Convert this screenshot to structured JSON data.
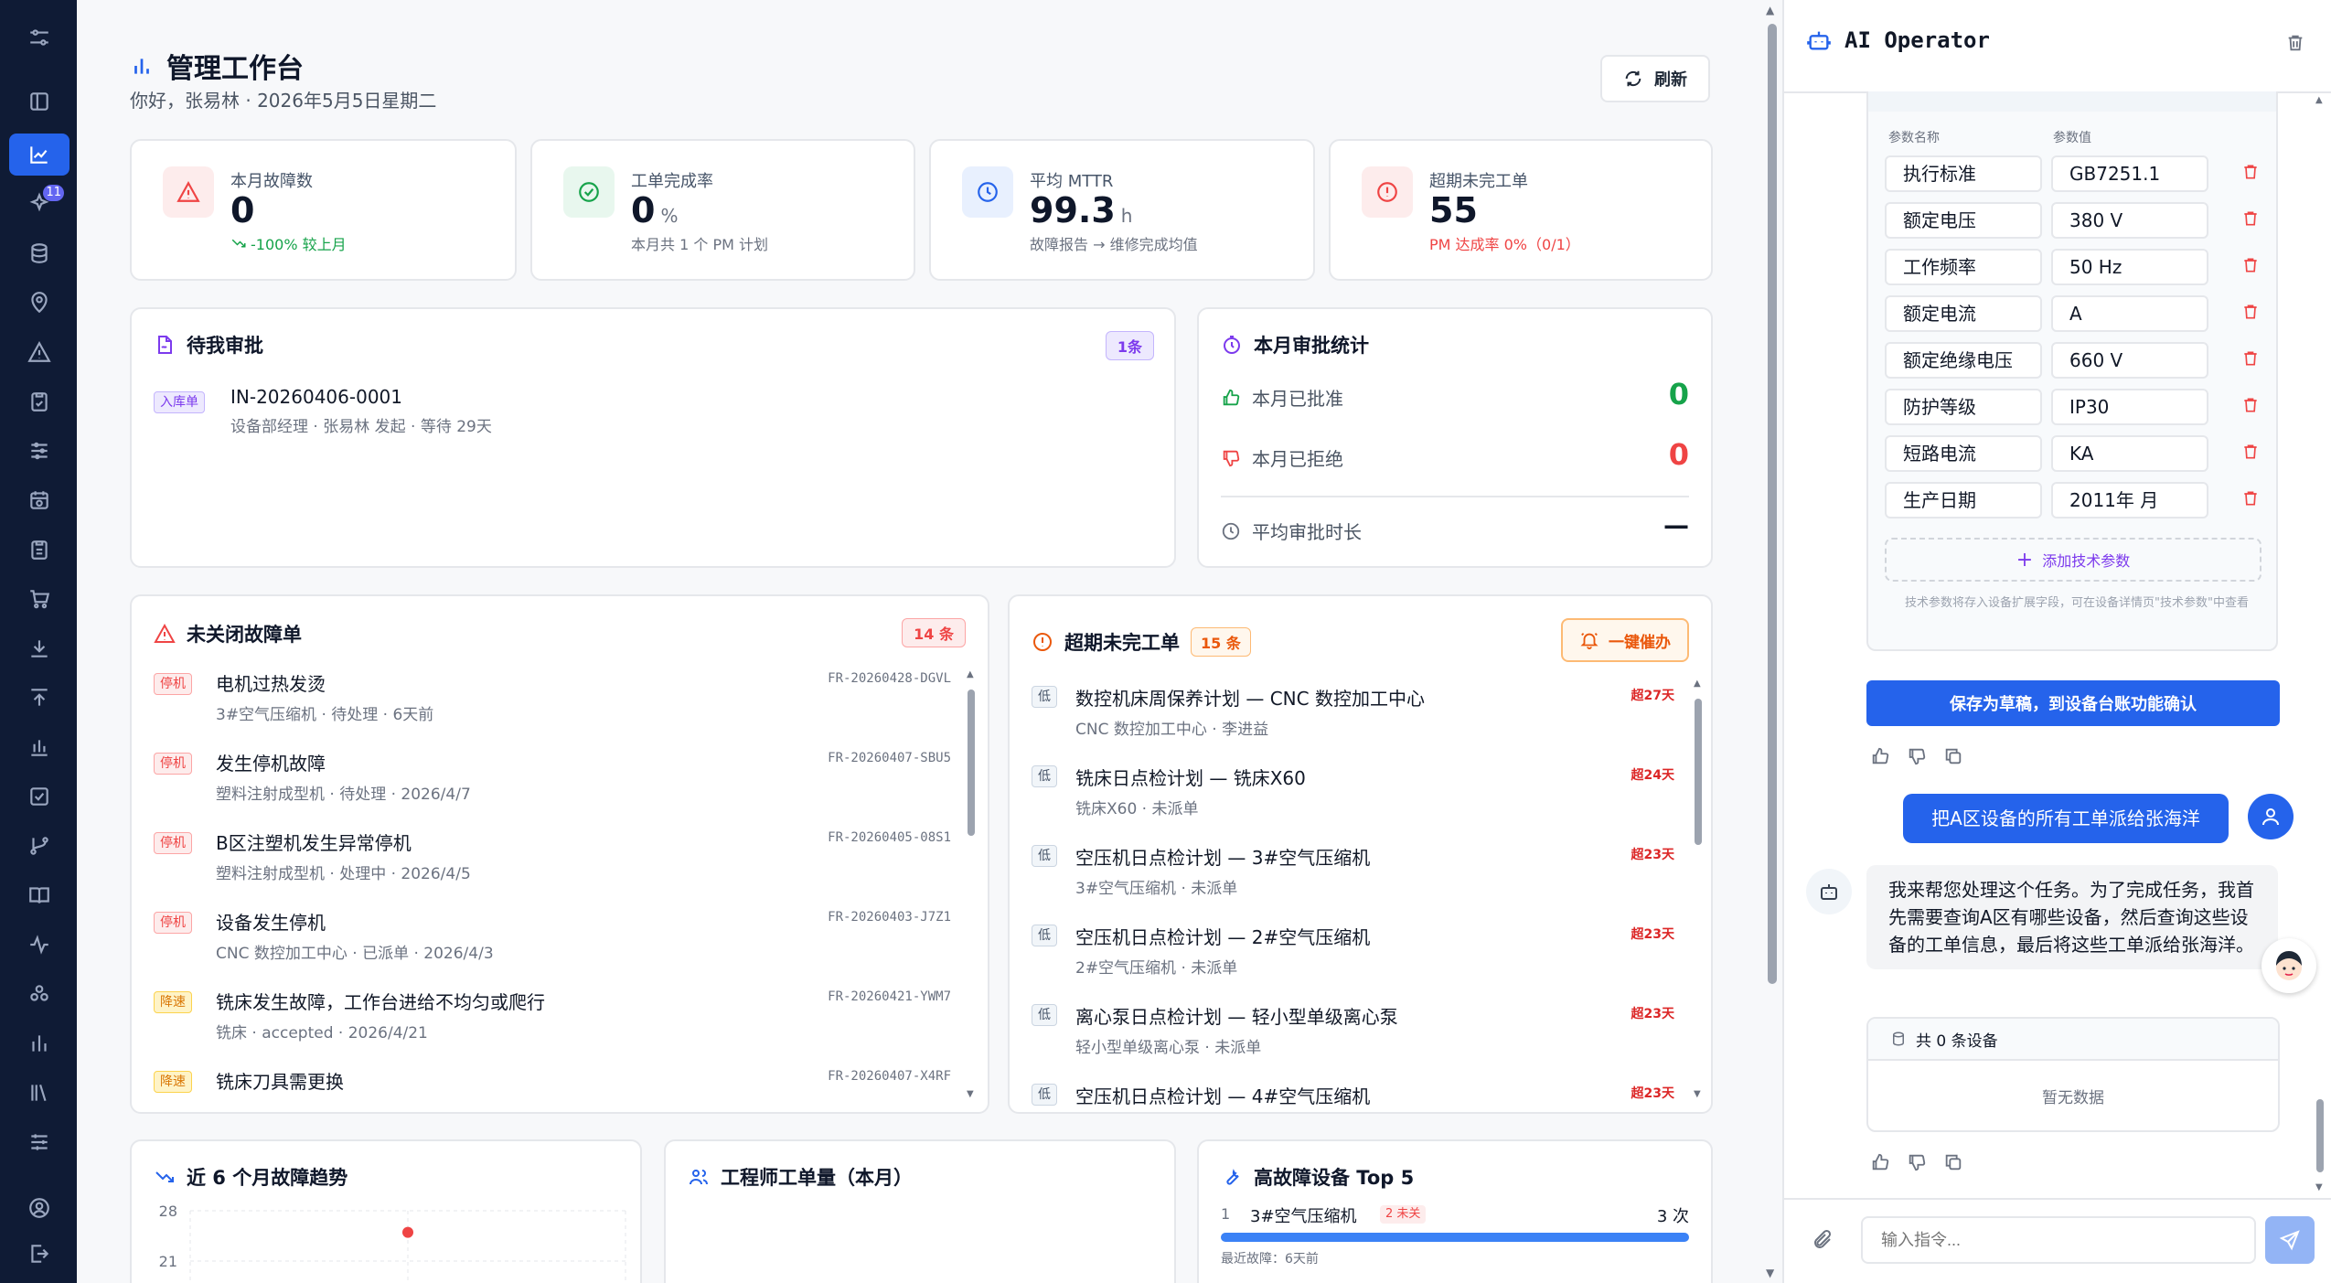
{
  "sidebar": {
    "items": [
      "settings-sliders-icon",
      "panel-icon",
      "trend-chart-icon",
      "sparkles-icon",
      "database-icon",
      "location-pin-icon",
      "alert-triangle-icon",
      "clipboard-check-icon",
      "sliders-icon",
      "calendar-clock-icon",
      "clipboard-list-icon",
      "cart-icon",
      "download-icon",
      "upload-icon",
      "bar-chart-icon",
      "check-square-icon",
      "git-branch-icon",
      "book-open-icon",
      "activity-icon",
      "apps-icon",
      "column-chart-icon",
      "library-icon",
      "filters-icon"
    ],
    "badge": "11",
    "bottom": [
      "user-circle-icon",
      "logout-icon"
    ]
  },
  "header": {
    "title": "管理工作台",
    "subtitle": "你好，张易林 · 2026年5月5日星期二",
    "refresh_label": "刷新"
  },
  "kpis": [
    {
      "label": "本月故障数",
      "value": "0",
      "unit": "",
      "sub": "-100% 较上月",
      "sub_color": "#16a34a",
      "icon": "alert-triangle-icon",
      "icon_bg": "#fdecec",
      "icon_color": "#ef4444"
    },
    {
      "label": "工单完成率",
      "value": "0",
      "unit": "%",
      "sub": "本月共 1 个 PM 计划",
      "sub_color": "#6b7280",
      "icon": "check-circle-icon",
      "icon_bg": "#e8f7ee",
      "icon_color": "#16a34a"
    },
    {
      "label": "平均 MTTR",
      "value": "99.3",
      "unit": "h",
      "sub": "故障报告 → 维修完成均值",
      "sub_color": "#6b7280",
      "icon": "clock-icon",
      "icon_bg": "#e8f0fe",
      "icon_color": "#2563eb"
    },
    {
      "label": "超期未完工单",
      "value": "55",
      "unit": "",
      "sub": "PM 达成率 0%（0/1）",
      "sub_color": "#ef4444",
      "icon": "alert-circle-icon",
      "icon_bg": "#fdecec",
      "icon_color": "#ef4444"
    }
  ],
  "approvals": {
    "title": "待我审批",
    "count": "1条",
    "items": [
      {
        "tag": "入库单",
        "id": "IN-20260406-0001",
        "sub": "设备部经理 · 张易林 发起 · 等待 29天"
      }
    ]
  },
  "approval_stats": {
    "title": "本月审批统计",
    "approved_label": "本月已批准",
    "approved_value": "0",
    "rejected_label": "本月已拒绝",
    "rejected_value": "0",
    "avg_label": "平均审批时长",
    "avg_value": "—"
  },
  "faults": {
    "title": "未关闭故障单",
    "count": "14 条",
    "items": [
      {
        "tag": "停机",
        "title": "电机过热发烫",
        "sub": "3#空气压缩机 · 待处理 · 6天前",
        "code": "FR-20260428-DGVL"
      },
      {
        "tag": "停机",
        "title": "发生停机故障",
        "sub": "塑料注射成型机 · 待处理 · 2026/4/7",
        "code": "FR-20260407-SBU5"
      },
      {
        "tag": "停机",
        "title": "B区注塑机发生异常停机",
        "sub": "塑料注射成型机 · 处理中 · 2026/4/5",
        "code": "FR-20260405-08S1"
      },
      {
        "tag": "停机",
        "title": "设备发生停机",
        "sub": "CNC 数控加工中心 · 已派单 · 2026/4/3",
        "code": "FR-20260403-J7Z1"
      },
      {
        "tag": "降速",
        "title": "铣床发生故障，工作台进给不均匀或爬行",
        "sub": "铣床 · accepted · 2026/4/21",
        "code": "FR-20260421-YWM7"
      },
      {
        "tag": "降速",
        "title": "铣床刀具需更换",
        "sub": "",
        "code": "FR-20260407-X4RF"
      }
    ]
  },
  "overdue": {
    "title": "超期未完工单",
    "count": "15 条",
    "remind_label": "一键催办",
    "items": [
      {
        "tag": "低",
        "title": "数控机床周保养计划 — CNC 数控加工中心",
        "sub": "CNC 数控加工中心 · 李进益",
        "over": "超27天"
      },
      {
        "tag": "低",
        "title": "铣床日点检计划 — 铣床X60",
        "sub": "铣床X60 · 未派单",
        "over": "超24天"
      },
      {
        "tag": "低",
        "title": "空压机日点检计划 — 3#空气压缩机",
        "sub": "3#空气压缩机 · 未派单",
        "over": "超23天"
      },
      {
        "tag": "低",
        "title": "空压机日点检计划 — 2#空气压缩机",
        "sub": "2#空气压缩机 · 未派单",
        "over": "超23天"
      },
      {
        "tag": "低",
        "title": "离心泵日点检计划 — 轻小型单级离心泵",
        "sub": "轻小型单级离心泵 · 未派单",
        "over": "超23天"
      },
      {
        "tag": "低",
        "title": "空压机日点检计划 — 4#空气压缩机",
        "sub": "",
        "over": "超23天"
      }
    ]
  },
  "trend": {
    "title": "近 6 个月故障趋势",
    "ticks": [
      "28",
      "21"
    ]
  },
  "chart_data": {
    "type": "line",
    "title": "近 6 个月故障趋势",
    "xlabel": "",
    "ylabel": "",
    "y_ticks": [
      28,
      21
    ],
    "points_visible": [
      {
        "x_index": 1,
        "y": 25
      }
    ]
  },
  "engineers": {
    "title": "工程师工单量（本月）"
  },
  "top5": {
    "title": "高故障设备 Top 5",
    "items": [
      {
        "rank": "1",
        "name": "3#空气压缩机",
        "tag": "2 未关",
        "count": "3 次",
        "sub": "最近故障：6天前",
        "fill": 1.0
      }
    ]
  },
  "chat": {
    "title": "AI Operator",
    "param_name_header": "参数名称",
    "param_value_header": "参数值",
    "params": [
      {
        "name": "执行标准",
        "value": "GB7251.1"
      },
      {
        "name": "额定电压",
        "value": "380 V"
      },
      {
        "name": "工作频率",
        "value": "50 Hz"
      },
      {
        "name": "额定电流",
        "value": "A"
      },
      {
        "name": "额定绝缘电压",
        "value": "660 V"
      },
      {
        "name": "防护等级",
        "value": "IP30"
      },
      {
        "name": "短路电流",
        "value": "KA"
      },
      {
        "name": "生产日期",
        "value": "2011年 月"
      }
    ],
    "add_param_label": "添加技术参数",
    "param_hint": "技术参数将存入设备扩展字段，可在设备详情页\"技术参数\"中查看",
    "save_label": "保存为草稿，到设备台账功能确认",
    "user_message": "把A区设备的所有工单派给张海洋",
    "bot_message": "我来帮您处理这个任务。为了完成任务，我首先需要查询A区有哪些设备，然后查询这些设备的工单信息，最后将这些工单派给张海洋。",
    "result_title": "共 0 条设备",
    "result_empty": "暂无数据",
    "input_placeholder": "输入指令..."
  }
}
